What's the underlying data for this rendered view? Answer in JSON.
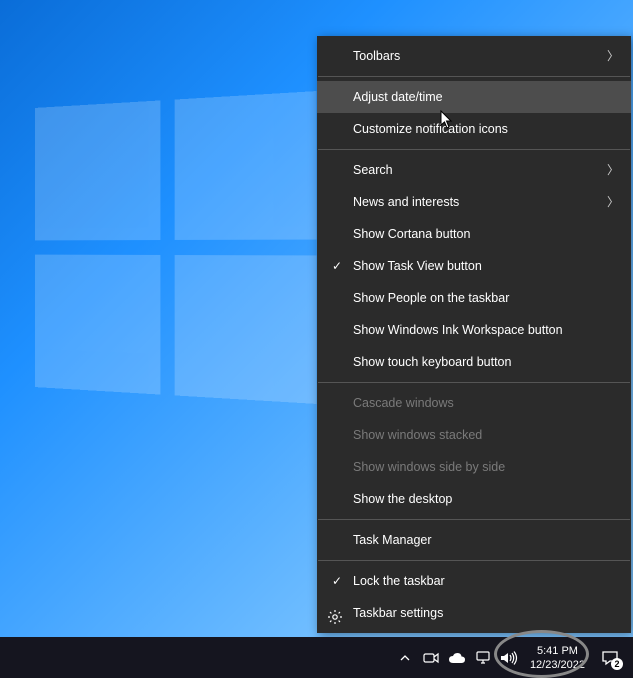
{
  "menu": {
    "toolbars": "Toolbars",
    "adjust_datetime": "Adjust date/time",
    "customize_notif": "Customize notification icons",
    "search": "Search",
    "news": "News and interests",
    "show_cortana": "Show Cortana button",
    "show_taskview": "Show Task View button",
    "show_people": "Show People on the taskbar",
    "show_ink": "Show Windows Ink Workspace button",
    "show_touchkb": "Show touch keyboard button",
    "cascade": "Cascade windows",
    "stacked": "Show windows stacked",
    "sidebyside": "Show windows side by side",
    "show_desktop": "Show the desktop",
    "taskmgr": "Task Manager",
    "lock_taskbar": "Lock the taskbar",
    "taskbar_settings": "Taskbar settings"
  },
  "taskbar": {
    "time": "5:41 PM",
    "date": "12/23/2022",
    "notification_count": "2"
  }
}
